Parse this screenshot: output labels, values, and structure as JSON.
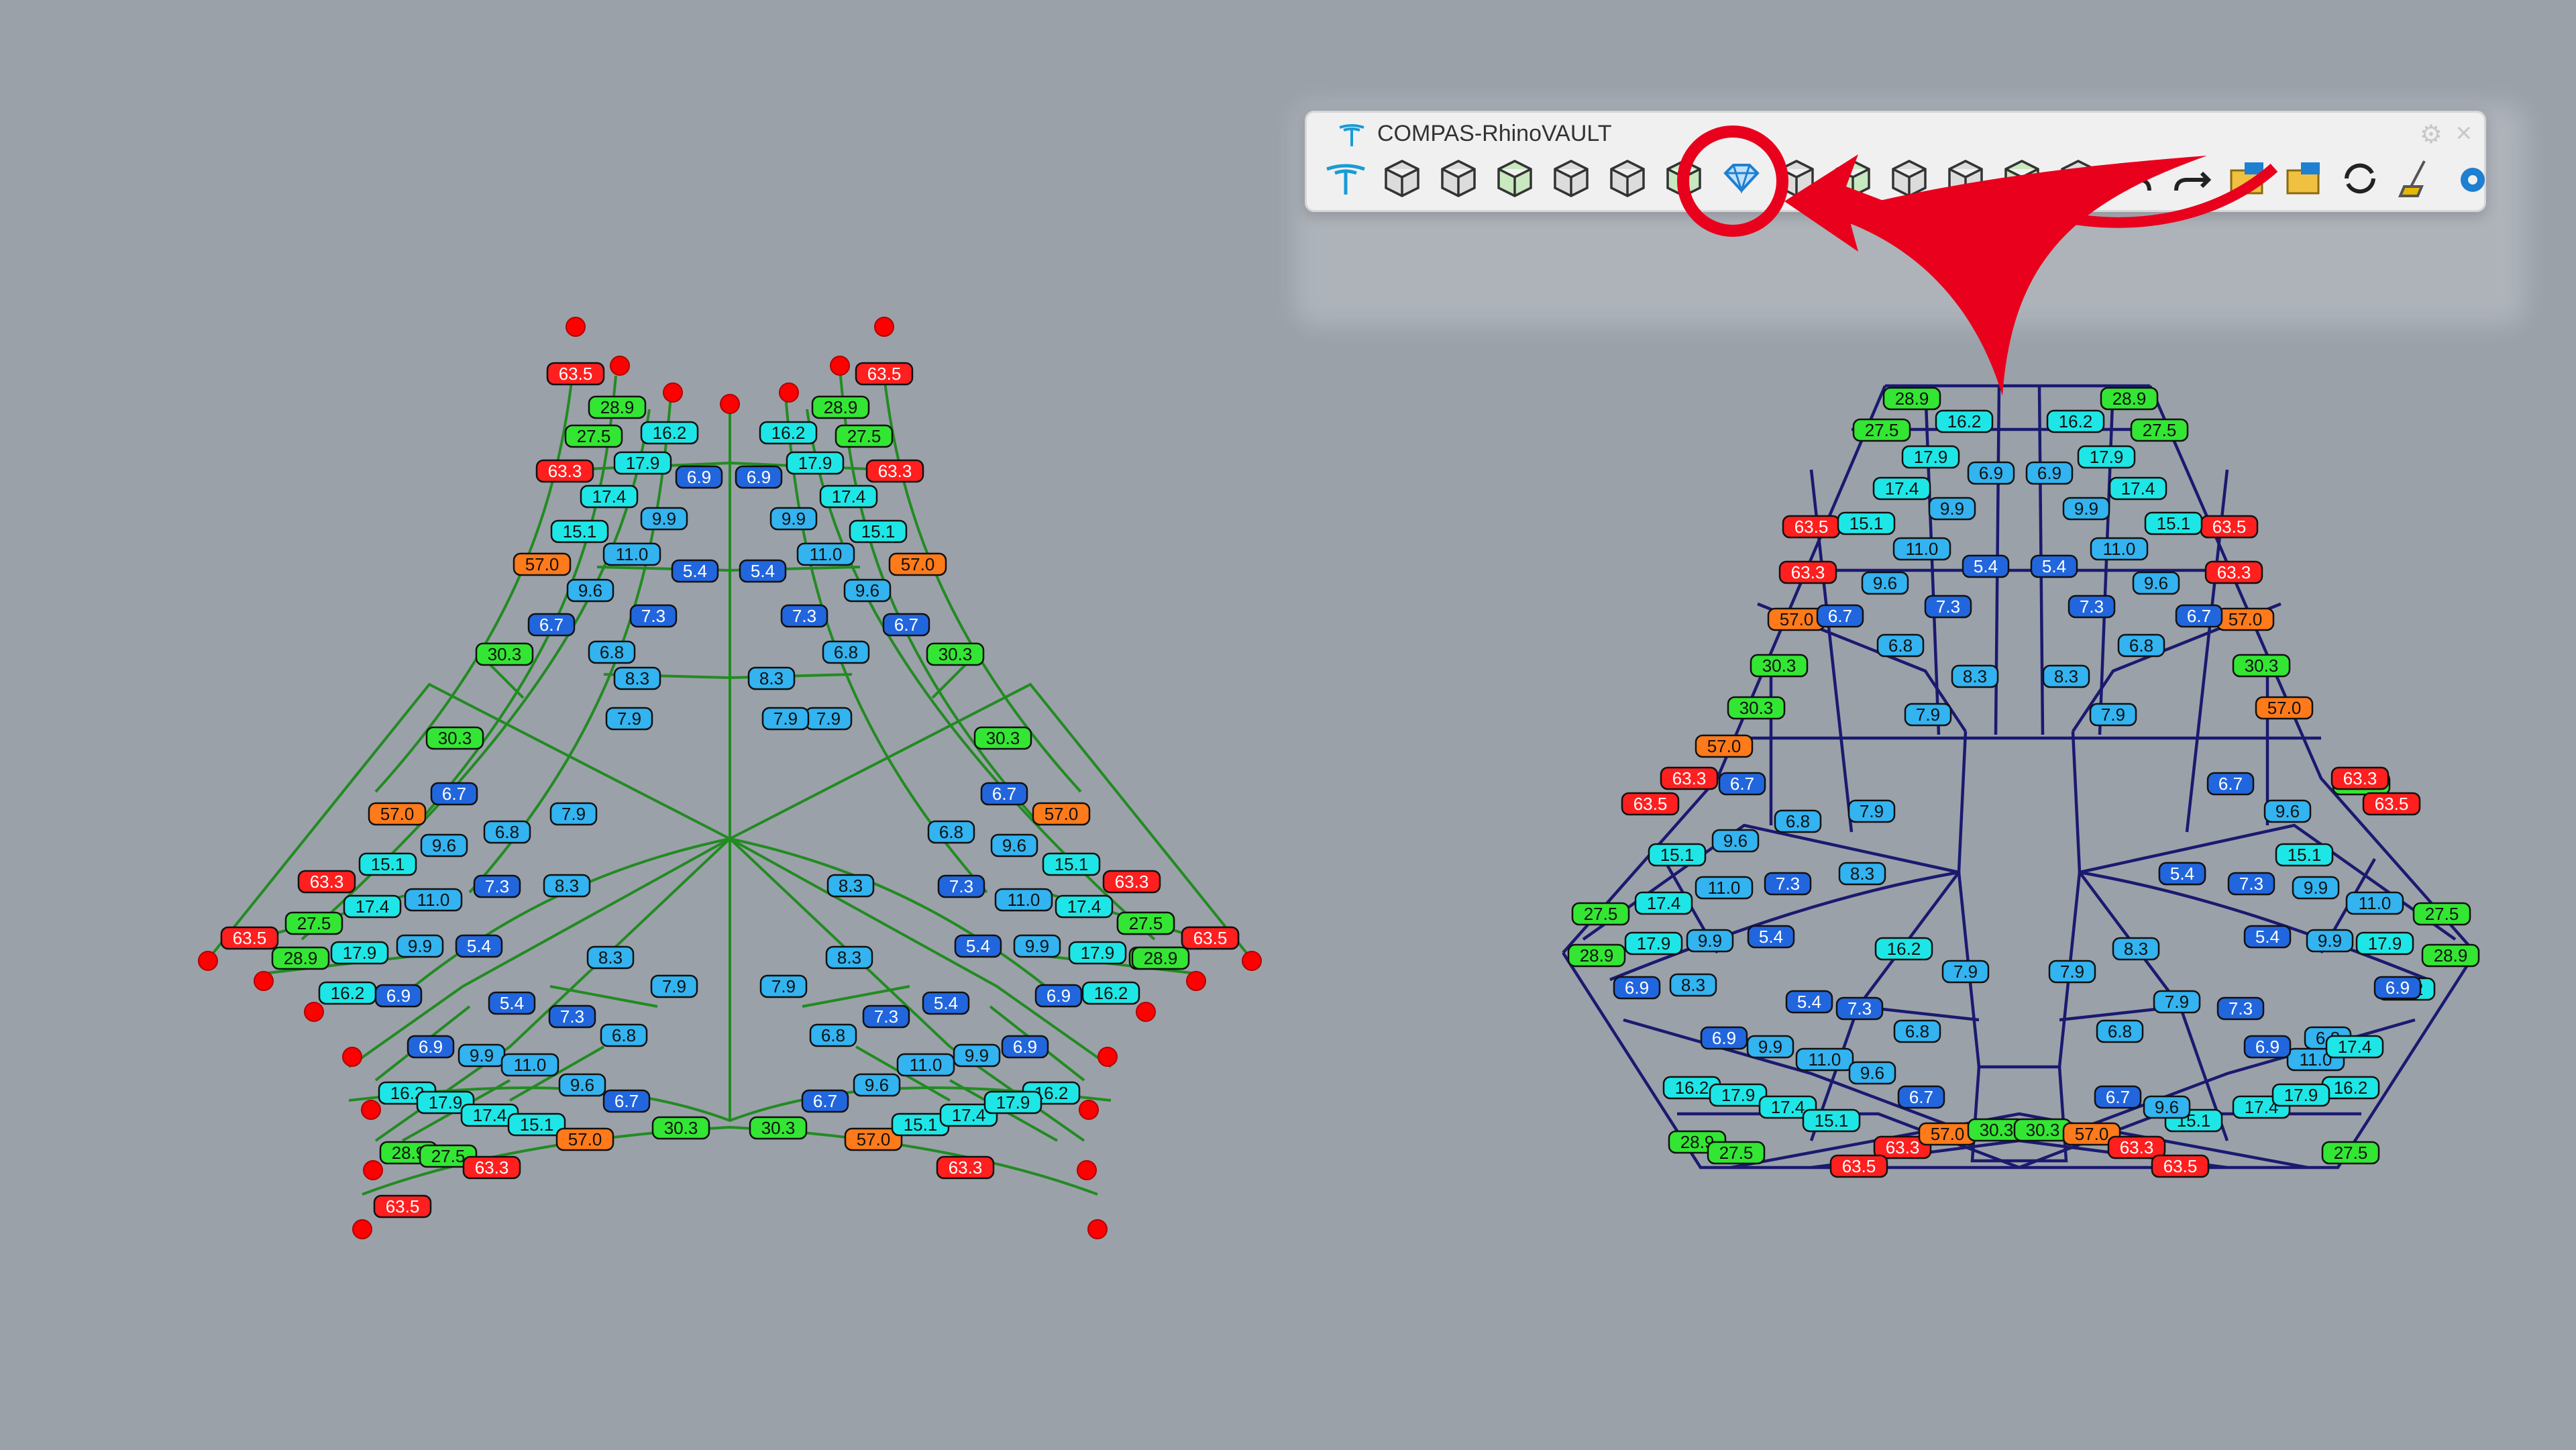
{
  "window": {
    "title": "COMPAS-RhinoVAULT"
  },
  "toolbar": {
    "icons": [
      "rhinovault-logo-icon",
      "pattern-mesh-icon",
      "pattern-box-icon",
      "pattern-dome-icon",
      "form-diagram-icon",
      "supports-icon",
      "boundaries-icon",
      "form-create-icon",
      "force-create-icon",
      "horizontal-equilibrium-icon",
      "vertical-equilibrium-icon",
      "modify-form-icon",
      "modify-force-icon",
      "clear-icon",
      "undo-icon",
      "redo-icon",
      "open-session-icon",
      "save-session-icon",
      "redraw-icon",
      "broom-icon",
      "settings-gear-icon"
    ],
    "highlighted_icon": "form-create-icon"
  },
  "colors": {
    "background": "#9ba1a9",
    "form_edge": "#228b22",
    "force_edge": "#1a1a70",
    "highlight": "#e8001c",
    "support": "#ff0000"
  },
  "label_colors": {
    "red": "#ff1f1f",
    "green": "#33e633",
    "cyan": "#1fe6e6",
    "lightblue": "#33b3f0",
    "blue": "#2266dd",
    "orange": "#ff7a1a"
  },
  "form_labels": [
    [
      "63.5",
      "red"
    ],
    [
      "28.9",
      "green"
    ],
    [
      "27.5",
      "green"
    ],
    [
      "16.2",
      "cyan"
    ],
    [
      "63.3",
      "red"
    ],
    [
      "17.9",
      "cyan"
    ],
    [
      "6.9",
      "blue"
    ],
    [
      "17.4",
      "cyan"
    ],
    [
      "15.1",
      "cyan"
    ],
    [
      "9.9",
      "lightblue"
    ],
    [
      "11.0",
      "lightblue"
    ],
    [
      "57.0",
      "orange"
    ],
    [
      "9.6",
      "lightblue"
    ],
    [
      "5.4",
      "blue"
    ],
    [
      "6.7",
      "blue"
    ],
    [
      "7.3",
      "blue"
    ],
    [
      "6.8",
      "lightblue"
    ],
    [
      "8.3",
      "lightblue"
    ],
    [
      "30.3",
      "green"
    ],
    [
      "7.9",
      "lightblue"
    ],
    [
      "63.5",
      "red"
    ],
    [
      "28.9",
      "green"
    ],
    [
      "27.5",
      "green"
    ],
    [
      "16.2",
      "cyan"
    ],
    [
      "63.3",
      "red"
    ],
    [
      "17.9",
      "cyan"
    ],
    [
      "6.9",
      "blue"
    ],
    [
      "17.4",
      "cyan"
    ],
    [
      "15.1",
      "cyan"
    ],
    [
      "9.9",
      "lightblue"
    ],
    [
      "11.0",
      "lightblue"
    ],
    [
      "57.0",
      "orange"
    ],
    [
      "9.6",
      "lightblue"
    ],
    [
      "5.4",
      "blue"
    ],
    [
      "6.7",
      "blue"
    ],
    [
      "7.3",
      "blue"
    ],
    [
      "6.8",
      "lightblue"
    ],
    [
      "8.3",
      "lightblue"
    ],
    [
      "30.3",
      "green"
    ],
    [
      "7.9",
      "lightblue"
    ],
    [
      "30.3",
      "green"
    ],
    [
      "57.0",
      "orange"
    ],
    [
      "6.7",
      "blue"
    ],
    [
      "6.8",
      "lightblue"
    ],
    [
      "7.9",
      "lightblue"
    ],
    [
      "9.6",
      "lightblue"
    ],
    [
      "15.1",
      "cyan"
    ],
    [
      "63.3",
      "red"
    ],
    [
      "7.3",
      "blue"
    ],
    [
      "8.3",
      "lightblue"
    ],
    [
      "17.4",
      "cyan"
    ],
    [
      "11.0",
      "lightblue"
    ],
    [
      "27.5",
      "green"
    ],
    [
      "63.5",
      "red"
    ],
    [
      "9.9",
      "lightblue"
    ],
    [
      "5.4",
      "blue"
    ],
    [
      "28.9",
      "green"
    ],
    [
      "17.9",
      "cyan"
    ],
    [
      "8.3",
      "lightblue"
    ],
    [
      "16.2",
      "cyan"
    ],
    [
      "6.9",
      "blue"
    ],
    [
      "5.4",
      "blue"
    ],
    [
      "7.9",
      "lightblue"
    ],
    [
      "7.3",
      "blue"
    ],
    [
      "6.9",
      "blue"
    ],
    [
      "9.9",
      "lightblue"
    ],
    [
      "6.8",
      "lightblue"
    ],
    [
      "11.0",
      "lightblue"
    ],
    [
      "9.6",
      "lightblue"
    ],
    [
      "16.2",
      "cyan"
    ],
    [
      "17.9",
      "cyan"
    ],
    [
      "6.7",
      "blue"
    ],
    [
      "17.4",
      "cyan"
    ],
    [
      "28.9",
      "green"
    ],
    [
      "15.1",
      "cyan"
    ],
    [
      "27.5",
      "green"
    ],
    [
      "57.0",
      "orange"
    ],
    [
      "63.3",
      "red"
    ],
    [
      "63.5",
      "red"
    ],
    [
      "30.3",
      "green"
    ],
    [
      "30.3",
      "green"
    ],
    [
      "57.0",
      "orange"
    ],
    [
      "6.7",
      "blue"
    ],
    [
      "6.8",
      "lightblue"
    ],
    [
      "7.9",
      "lightblue"
    ],
    [
      "9.6",
      "lightblue"
    ],
    [
      "15.1",
      "cyan"
    ],
    [
      "63.3",
      "red"
    ],
    [
      "7.3",
      "blue"
    ],
    [
      "8.3",
      "lightblue"
    ],
    [
      "17.4",
      "cyan"
    ],
    [
      "11.0",
      "lightblue"
    ],
    [
      "27.5",
      "green"
    ],
    [
      "63.5",
      "red"
    ],
    [
      "9.9",
      "lightblue"
    ],
    [
      "5.4",
      "blue"
    ],
    [
      "28.9",
      "green"
    ],
    [
      "17.9",
      "cyan"
    ],
    [
      "8.3",
      "lightblue"
    ],
    [
      "16.2",
      "cyan"
    ],
    [
      "6.9",
      "blue"
    ],
    [
      "5.4",
      "blue"
    ],
    [
      "7.9",
      "lightblue"
    ],
    [
      "7.3",
      "blue"
    ],
    [
      "6.9",
      "blue"
    ],
    [
      "9.9",
      "lightblue"
    ],
    [
      "6.8",
      "lightblue"
    ],
    [
      "11.0",
      "lightblue"
    ],
    [
      "9.6",
      "lightblue"
    ],
    [
      "16.2",
      "cyan"
    ],
    [
      "17.9",
      "cyan"
    ],
    [
      "6.7",
      "blue"
    ],
    [
      "17.4",
      "cyan"
    ],
    [
      "28.9",
      "green"
    ],
    [
      "15.1",
      "cyan"
    ],
    [
      "27.5",
      "green"
    ],
    [
      "57.0",
      "orange"
    ],
    [
      "63.3",
      "red"
    ],
    [
      "63.5",
      "red"
    ],
    [
      "30.3",
      "green"
    ]
  ],
  "force_labels": [
    [
      "28.9",
      "green"
    ],
    [
      "16.2",
      "cyan"
    ],
    [
      "27.5",
      "green"
    ],
    [
      "17.9",
      "cyan"
    ],
    [
      "6.9",
      "lightblue"
    ],
    [
      "17.4",
      "cyan"
    ],
    [
      "9.9",
      "lightblue"
    ],
    [
      "63.5",
      "red"
    ],
    [
      "15.1",
      "cyan"
    ],
    [
      "11.0",
      "lightblue"
    ],
    [
      "5.4",
      "blue"
    ],
    [
      "63.3",
      "red"
    ],
    [
      "9.6",
      "lightblue"
    ],
    [
      "7.3",
      "blue"
    ],
    [
      "57.0",
      "orange"
    ],
    [
      "6.7",
      "blue"
    ],
    [
      "6.8",
      "lightblue"
    ],
    [
      "8.3",
      "lightblue"
    ],
    [
      "30.3",
      "green"
    ],
    [
      "7.9",
      "lightblue"
    ],
    [
      "28.9",
      "green"
    ],
    [
      "16.2",
      "cyan"
    ],
    [
      "27.5",
      "green"
    ],
    [
      "17.9",
      "cyan"
    ],
    [
      "6.9",
      "lightblue"
    ],
    [
      "17.4",
      "cyan"
    ],
    [
      "9.9",
      "lightblue"
    ],
    [
      "63.5",
      "red"
    ],
    [
      "15.1",
      "cyan"
    ],
    [
      "11.0",
      "lightblue"
    ],
    [
      "5.4",
      "blue"
    ],
    [
      "63.3",
      "red"
    ],
    [
      "9.6",
      "lightblue"
    ],
    [
      "7.3",
      "blue"
    ],
    [
      "57.0",
      "orange"
    ],
    [
      "6.7",
      "blue"
    ],
    [
      "6.8",
      "lightblue"
    ],
    [
      "8.3",
      "lightblue"
    ],
    [
      "30.3",
      "green"
    ],
    [
      "7.9",
      "lightblue"
    ],
    [
      "30.3",
      "green"
    ],
    [
      "57.0",
      "orange"
    ],
    [
      "63.3",
      "red"
    ],
    [
      "63.5",
      "red"
    ],
    [
      "6.7",
      "blue"
    ],
    [
      "6.8",
      "lightblue"
    ],
    [
      "7.9",
      "lightblue"
    ],
    [
      "15.1",
      "cyan"
    ],
    [
      "9.6",
      "lightblue"
    ],
    [
      "8.3",
      "lightblue"
    ],
    [
      "27.5",
      "green"
    ],
    [
      "17.4",
      "cyan"
    ],
    [
      "11.0",
      "lightblue"
    ],
    [
      "7.3",
      "blue"
    ],
    [
      "28.9",
      "green"
    ],
    [
      "17.9",
      "cyan"
    ],
    [
      "9.9",
      "lightblue"
    ],
    [
      "5.4",
      "blue"
    ],
    [
      "16.2",
      "cyan"
    ],
    [
      "6.9",
      "blue"
    ],
    [
      "8.3",
      "lightblue"
    ],
    [
      "7.9",
      "lightblue"
    ],
    [
      "5.4",
      "blue"
    ],
    [
      "7.3",
      "blue"
    ],
    [
      "6.8",
      "lightblue"
    ],
    [
      "6.9",
      "blue"
    ],
    [
      "9.9",
      "lightblue"
    ],
    [
      "11.0",
      "lightblue"
    ],
    [
      "9.6",
      "lightblue"
    ],
    [
      "16.2",
      "cyan"
    ],
    [
      "17.9",
      "cyan"
    ],
    [
      "17.4",
      "cyan"
    ],
    [
      "6.7",
      "blue"
    ],
    [
      "15.1",
      "cyan"
    ],
    [
      "28.9",
      "green"
    ],
    [
      "27.5",
      "green"
    ],
    [
      "63.3",
      "red"
    ],
    [
      "57.0",
      "orange"
    ],
    [
      "30.3",
      "green"
    ],
    [
      "63.5",
      "red"
    ],
    [
      "30.3",
      "green"
    ],
    [
      "57.0",
      "orange"
    ],
    [
      "63.3",
      "red"
    ],
    [
      "63.5",
      "red"
    ],
    [
      "6.7",
      "blue"
    ],
    [
      "6.8",
      "lightblue"
    ],
    [
      "7.9",
      "lightblue"
    ],
    [
      "15.1",
      "cyan"
    ],
    [
      "9.6",
      "lightblue"
    ],
    [
      "8.3",
      "lightblue"
    ],
    [
      "27.5",
      "green"
    ],
    [
      "17.4",
      "cyan"
    ],
    [
      "11.0",
      "lightblue"
    ],
    [
      "7.3",
      "blue"
    ],
    [
      "28.9",
      "green"
    ],
    [
      "17.9",
      "cyan"
    ],
    [
      "9.9",
      "lightblue"
    ],
    [
      "5.4",
      "blue"
    ],
    [
      "16.2",
      "cyan"
    ],
    [
      "6.9",
      "blue"
    ],
    [
      "8.3",
      "lightblue"
    ],
    [
      "7.9",
      "lightblue"
    ],
    [
      "5.4",
      "blue"
    ],
    [
      "7.3",
      "blue"
    ],
    [
      "6.8",
      "lightblue"
    ],
    [
      "6.9",
      "blue"
    ],
    [
      "9.9",
      "lightblue"
    ],
    [
      "11.0",
      "lightblue"
    ],
    [
      "9.6",
      "lightblue"
    ],
    [
      "16.2",
      "cyan"
    ],
    [
      "17.9",
      "cyan"
    ],
    [
      "17.4",
      "cyan"
    ],
    [
      "6.7",
      "blue"
    ],
    [
      "15.1",
      "cyan"
    ],
    [
      "28.9",
      "green"
    ],
    [
      "27.5",
      "green"
    ],
    [
      "63.3",
      "red"
    ],
    [
      "57.0",
      "orange"
    ],
    [
      "63.5",
      "red"
    ]
  ]
}
